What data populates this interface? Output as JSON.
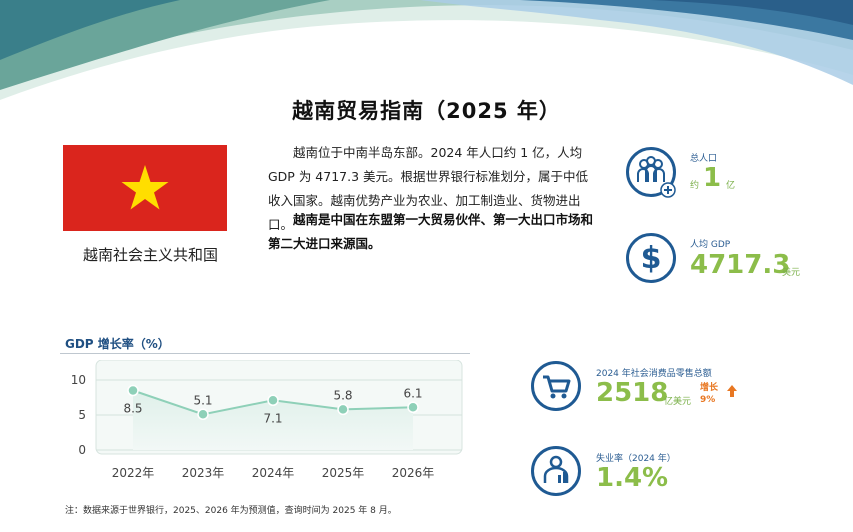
{
  "title": "越南贸易指南（2025 年）",
  "country": {
    "name": "越南社会主义共和国",
    "flag_colors": {
      "field": "#da251d",
      "star": "#ffde00"
    }
  },
  "intro": {
    "paragraph": "越南位于中南半岛东部。2024 年人口约 1 亿，人均 GDP 为 4717.3 美元。根据世界银行标准划分，属于中低收入国家。越南优势产业为农业、加工制造业、货物进出口。",
    "bold": "越南是中国在东盟第一大贸易伙伴、第一大出口市场和第二大进口来源国。"
  },
  "stats": {
    "population": {
      "label": "总人口",
      "prefix": "约",
      "value": "1",
      "unit": "亿",
      "icon": "people-icon"
    },
    "gdp_per_capita": {
      "label": "人均 GDP",
      "value": "4717.3",
      "unit": "美元",
      "icon": "dollar-icon"
    },
    "retail_sales": {
      "label": "2024 年社会消费品零售总额",
      "value": "2518",
      "unit": "亿美元",
      "growth_label": "增长",
      "growth_value": "9%",
      "icon": "cart-icon"
    },
    "unemployment": {
      "label": "失业率（2024 年）",
      "value": "1.4%",
      "icon": "person-chart-icon"
    }
  },
  "chart_data": {
    "type": "line",
    "title": "GDP 增长率（%）",
    "categories": [
      "2022年",
      "2023年",
      "2024年",
      "2025年",
      "2026年"
    ],
    "values": [
      8.5,
      5.1,
      7.1,
      5.8,
      6.1
    ],
    "labels": [
      "8.5",
      "5.1",
      "7.1",
      "5.8",
      "6.1"
    ],
    "ylim": [
      0,
      10
    ],
    "yticks": [
      "0",
      "5",
      "10"
    ],
    "grid": true,
    "colors": {
      "line": "#8ed0b8",
      "area_top": "#dff0ea",
      "area_bottom": "#f2f8f6"
    }
  },
  "note": "注：数据来源于世界银行，2025、2026 年为预测值，查询时间为 2025 年 8 月。"
}
